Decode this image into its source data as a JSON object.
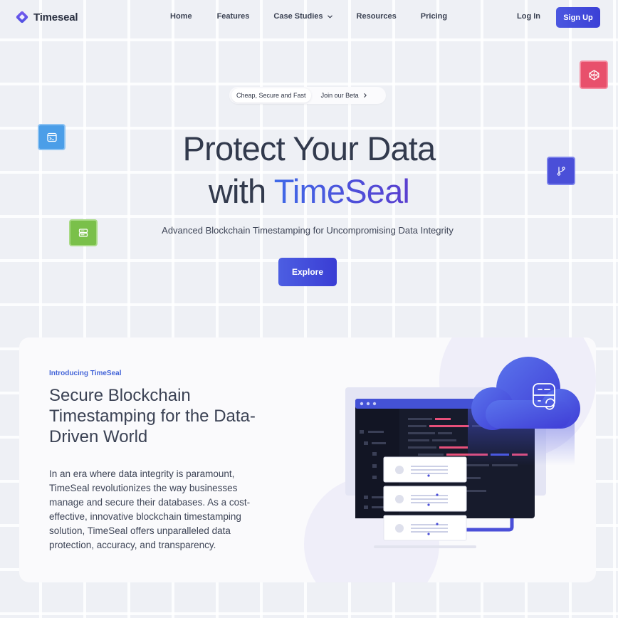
{
  "brand": {
    "name": "Timeseal",
    "accent": "#4b57e0"
  },
  "nav": {
    "links": [
      {
        "label": "Home"
      },
      {
        "label": "Features"
      },
      {
        "label": "Case Studies",
        "icon": "chevron-down-icon"
      },
      {
        "label": "Resources"
      },
      {
        "label": "Pricing"
      }
    ],
    "login": "Log In",
    "signup": "Sign Up"
  },
  "announcement": {
    "tag": "Cheap, Secure and Fast",
    "link": "Join our Beta",
    "icon": "chevron-right-icon"
  },
  "hero": {
    "title_line1": "Protect Your Data",
    "title_line2_prefix": "with ",
    "title_line2_brand": "TimeSeal",
    "subtitle": "Advanced Blockchain Timestamping for Uncompromising Data Integrity",
    "cta": "Explore"
  },
  "floating_icons": [
    {
      "name": "terminal-window-icon",
      "color": "#4b9ee8"
    },
    {
      "name": "database-icon",
      "color": "#7ac04a"
    },
    {
      "name": "git-branch-icon",
      "color": "#4a4fd8"
    },
    {
      "name": "codepen-cube-icon",
      "color": "#e8506c"
    }
  ],
  "intro": {
    "eyebrow": "Introducing TimeSeal",
    "title": "Secure Blockchain Timestamping for the Data-Driven World",
    "body": "In an era where data integrity is paramount, TimeSeal revolutionizes the way businesses manage and secure their databases. As a cost-effective, innovative blockchain timestamping solution, TimeSeal offers unparalleled data protection, accuracy, and transparency."
  }
}
